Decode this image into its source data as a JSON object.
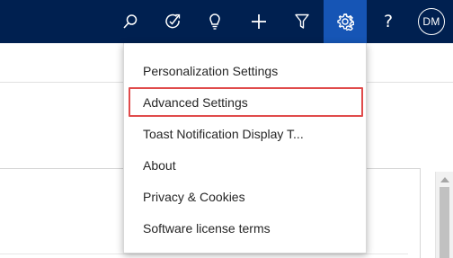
{
  "topbar": {
    "background": "#002050",
    "active_background": "#1655b5",
    "icons": [
      {
        "name": "search-icon",
        "active": false
      },
      {
        "name": "task-flow-icon",
        "active": false
      },
      {
        "name": "lightbulb-icon",
        "active": false
      },
      {
        "name": "plus-icon",
        "active": false
      },
      {
        "name": "filter-icon",
        "active": false
      },
      {
        "name": "gear-icon",
        "active": true
      },
      {
        "name": "help-icon",
        "active": false
      }
    ],
    "help_glyph": "?",
    "user_initials": "DM"
  },
  "settings_menu": {
    "items": [
      {
        "label": "Personalization Settings"
      },
      {
        "label": "Advanced Settings",
        "highlighted": true
      },
      {
        "label": "Toast Notification Display T..."
      },
      {
        "label": "About"
      },
      {
        "label": "Privacy & Cookies"
      },
      {
        "label": "Software license terms"
      }
    ],
    "highlight_color": "#e04b4b"
  }
}
